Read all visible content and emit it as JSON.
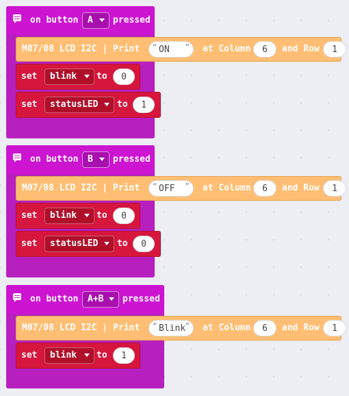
{
  "events": [
    {
      "label_on": "on button",
      "button": "A",
      "label_pressed": "pressed",
      "print": {
        "label": "M07/08 LCD I2C | Print",
        "text": "ON",
        "at_column": "at Column",
        "column": "6",
        "and_row": "and Row",
        "row": "1"
      },
      "set1": {
        "label": "set",
        "var": "blink",
        "to": "to",
        "value": "0"
      },
      "set2": {
        "label": "set",
        "var": "statusLED",
        "to": "to",
        "value": "1"
      }
    },
    {
      "label_on": "on button",
      "button": "B",
      "label_pressed": "pressed",
      "print": {
        "label": "M07/08 LCD I2C | Print",
        "text": "OFF",
        "at_column": "at Column",
        "column": "6",
        "and_row": "and Row",
        "row": "1"
      },
      "set1": {
        "label": "set",
        "var": "blink",
        "to": "to",
        "value": "0"
      },
      "set2": {
        "label": "set",
        "var": "statusLED",
        "to": "to",
        "value": "0"
      }
    },
    {
      "label_on": "on button",
      "button": "A+B",
      "label_pressed": "pressed",
      "print": {
        "label": "M07/08 LCD I2C | Print",
        "text": "Blink",
        "at_column": "at Column",
        "column": "6",
        "and_row": "and Row",
        "row": "1"
      },
      "set1": {
        "label": "set",
        "var": "blink",
        "to": "to",
        "value": "1"
      }
    }
  ],
  "icons": {
    "comment": "comment-icon",
    "dropdown": "chevron-down-icon"
  },
  "colors": {
    "event": "#cc14d1",
    "lcd": "#ffbe73",
    "variables": "#d6163d",
    "background": "#eceef3"
  }
}
